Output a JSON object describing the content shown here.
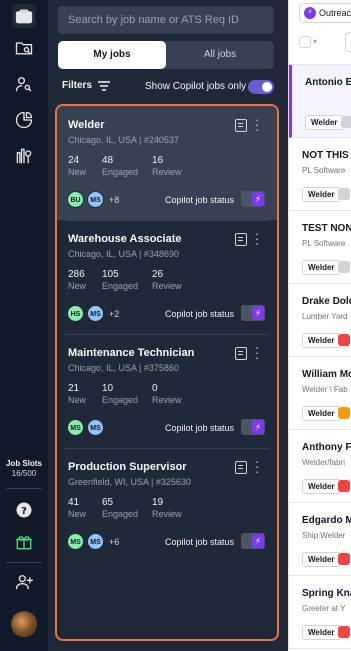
{
  "rail": {
    "icons": [
      "briefcase-icon",
      "folder-search-icon",
      "user-search-icon",
      "pie-chart-icon",
      "analytics-icon",
      "help-icon",
      "gift-icon",
      "add-user-icon"
    ],
    "job_slots_label": "Job Slots",
    "job_slots_value": "16/500"
  },
  "panel": {
    "search_placeholder": "Search by job name or ATS Req ID",
    "tabs": [
      "My jobs",
      "All jobs"
    ],
    "filters_label": "Filters",
    "copilot_only_label": "Show Copilot jobs only",
    "copilot_only_on": true
  },
  "jobs": [
    {
      "title": "Welder",
      "location": "Chicago, IL, USA | #240537",
      "stats": [
        {
          "value": "24",
          "label": "New"
        },
        {
          "value": "48",
          "label": "Engaged"
        },
        {
          "value": "16",
          "label": "Review"
        }
      ],
      "avatars": [
        {
          "initials": "BU",
          "color": "g"
        },
        {
          "initials": "MS",
          "color": "b"
        }
      ],
      "more": "+8",
      "copilot_status_label": "Copilot job status",
      "selected": true
    },
    {
      "title": "Warehouse Associate",
      "location": "Chicago, IL, USA | #348690",
      "stats": [
        {
          "value": "286",
          "label": "New"
        },
        {
          "value": "105",
          "label": "Engaged"
        },
        {
          "value": "26",
          "label": "Review"
        }
      ],
      "avatars": [
        {
          "initials": "HS",
          "color": "g"
        },
        {
          "initials": "MS",
          "color": "b"
        }
      ],
      "more": "+2",
      "copilot_status_label": "Copilot job status",
      "selected": false
    },
    {
      "title": "Maintenance Technician",
      "location": "Chicago, IL, USA | #375860",
      "stats": [
        {
          "value": "21",
          "label": "New"
        },
        {
          "value": "10",
          "label": "Engaged"
        },
        {
          "value": "0",
          "label": "Review"
        }
      ],
      "avatars": [
        {
          "initials": "MS",
          "color": "g"
        },
        {
          "initials": "MS",
          "color": "b"
        }
      ],
      "more": "",
      "copilot_status_label": "Copilot job status",
      "selected": false
    },
    {
      "title": "Production Supervisor",
      "location": "Greenfield, WI, USA | #325630",
      "stats": [
        {
          "value": "41",
          "label": "New"
        },
        {
          "value": "65",
          "label": "Engaged"
        },
        {
          "value": "19",
          "label": "Review"
        }
      ],
      "avatars": [
        {
          "initials": "MS",
          "color": "g"
        },
        {
          "initials": "MS",
          "color": "b"
        }
      ],
      "more": "+6",
      "copilot_status_label": "Copilot job status",
      "selected": false
    }
  ],
  "outreach": {
    "tab_label": "Outreach",
    "rows": [
      {
        "name": "Antonio Ed",
        "sub": "",
        "chip": "Welder",
        "status": "gray",
        "selected": true
      },
      {
        "name": "NOT THIS",
        "sub": "PL Software",
        "chip": "Welder",
        "status": "gray",
        "selected": false
      },
      {
        "name": "TEST NON",
        "sub": "PL Software",
        "chip": "Welder",
        "status": "gray",
        "selected": false
      },
      {
        "name": "Drake Dold",
        "sub": "Lumber Yard",
        "chip": "Welder",
        "status": "red",
        "selected": false
      },
      {
        "name": "William Mo",
        "sub": "Welder \\ Fab",
        "chip": "Welder",
        "status": "yellow",
        "selected": false
      },
      {
        "name": "Anthony F",
        "sub": "Welder/fabri",
        "chip": "Welder",
        "status": "red",
        "selected": false
      },
      {
        "name": "Edgardo M",
        "sub": "Ship Welder",
        "chip": "Welder",
        "status": "red",
        "selected": false
      },
      {
        "name": "Spring Kna",
        "sub": "Greeter at Y",
        "chip": "Welder",
        "status": "red",
        "selected": false
      }
    ]
  },
  "colors": {
    "rail_bg": "#111827",
    "panel_bg": "#1f2937",
    "accent": "#7c3aed",
    "highlight_border": "#e8744a"
  }
}
